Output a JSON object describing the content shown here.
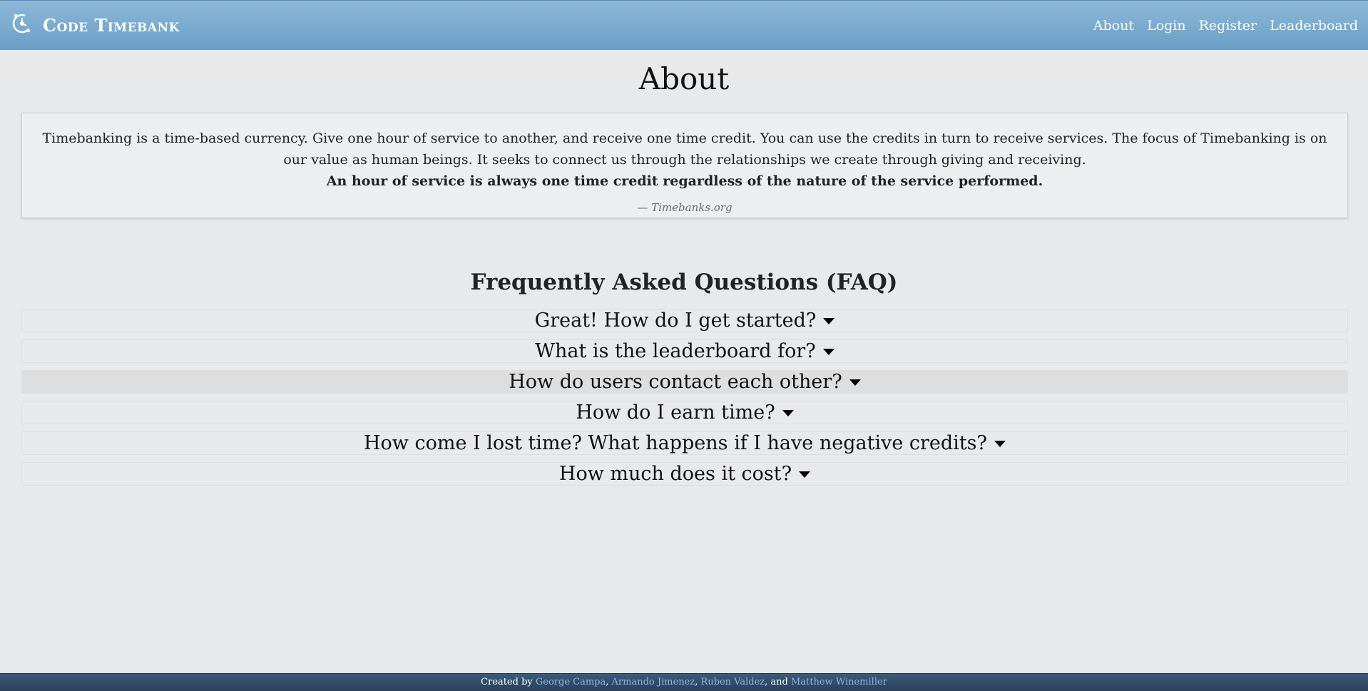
{
  "nav": {
    "brand": "Code Timebank",
    "links": [
      "About",
      "Login",
      "Register",
      "Leaderboard"
    ]
  },
  "page_title": "About",
  "quote": {
    "text": "Timebanking is a time-based currency. Give one hour of service to another, and receive one time credit. You can use the credits in turn to receive services. The focus of Timebanking is on our value as human beings. It seeks to connect us through the relationships we create through giving and receiving.",
    "emphasis": "An hour of service is always one time credit regardless of the nature of the service performed.",
    "source": "— Timebanks.org"
  },
  "faq": {
    "title": "Frequently Asked Questions (FAQ)",
    "items": [
      "Great! How do I get started?",
      "What is the leaderboard for?",
      "How do users contact each other?",
      "How do I earn time?",
      "How come I lost time? What happens if I have negative credits?",
      "How much does it cost?"
    ]
  },
  "footer": {
    "prefix": "Created by",
    "authors": [
      "George Campa",
      "Armando Jimenez",
      "Ruben Valdez",
      "Matthew Winemiller"
    ],
    "sep1": ",",
    "sep2": ",",
    "sep3": ", and"
  }
}
